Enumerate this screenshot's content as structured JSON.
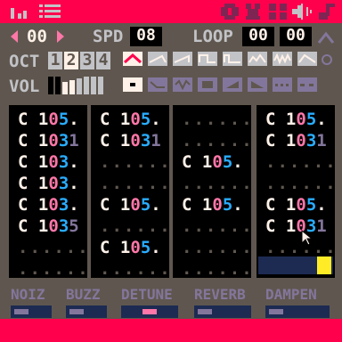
{
  "header": {
    "left_icons": [
      "music-note-icon",
      "grid-icon"
    ],
    "right_icons": [
      "eye-icon",
      "gear-icon",
      "palette-icon",
      "speaker-icon",
      "note-icon"
    ]
  },
  "controls": {
    "sfx_label": "00",
    "spd_label": "SPD",
    "spd_value": "08",
    "loop_label": "LOOP",
    "loop_start": "00",
    "loop_end": "00"
  },
  "octave": {
    "label": "OCT",
    "values": [
      "1",
      "2",
      "3",
      "4"
    ]
  },
  "volume": {
    "label": "VOL"
  },
  "waveforms": [
    "triangle",
    "tilted-saw",
    "saw",
    "square",
    "pulse",
    "organ",
    "noise",
    "phaser"
  ],
  "effects_row_icons": [
    "none",
    "slide",
    "vibrato",
    "drop",
    "fade-in",
    "fade-out",
    "arp-fast",
    "arp-slow"
  ],
  "channels": [
    {
      "rows": [
        "C 105.",
        "C 1031",
        "C 103.",
        "C 103.",
        "C 103.",
        "C 1035",
        "......",
        "......"
      ]
    },
    {
      "rows": [
        "C 105.",
        "C 1031",
        "......",
        "......",
        "C 105.",
        "......",
        "C 105.",
        "......"
      ]
    },
    {
      "rows": [
        "......",
        "......",
        "C 105.",
        "......",
        "C 105.",
        "......",
        "......",
        "......"
      ]
    },
    {
      "rows": [
        "C 105.",
        "C 1031",
        "......",
        "......",
        "C 105.",
        "C 1031",
        "......",
        "......"
      ]
    }
  ],
  "fx_labels": [
    "NOIZ",
    "BUZZ",
    "DETUNE",
    "REVERB",
    "DAMPEN"
  ],
  "colors": {
    "accent": "#ff004d",
    "panel": "#5f574f",
    "note_white": "#fff1e8",
    "note_pink": "#ff77a8",
    "note_blue": "#29adff"
  }
}
